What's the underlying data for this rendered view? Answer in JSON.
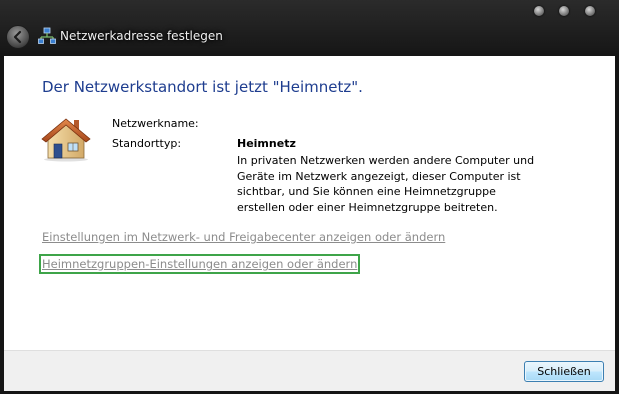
{
  "window": {
    "title": "Netzwerkadresse festlegen",
    "icons": {
      "back": "back-arrow-icon",
      "network": "network-icon",
      "location": "house-icon"
    }
  },
  "main": {
    "heading": "Der Netzwerkstandort ist jetzt \"Heimnetz\".",
    "network_name_label": "Netzwerkname:",
    "network_name_value": "",
    "location_type_label": "Standorttyp:",
    "location_type_value": "Heimnetz",
    "description": "In privaten Netzwerken werden andere Computer und Geräte im Netzwerk angezeigt, dieser Computer ist sichtbar, und Sie können eine Heimnetzgruppe erstellen oder einer Heimnetzgruppe beitreten.",
    "links": [
      {
        "label": "Einstellungen im Netzwerk- und Freigabecenter anzeigen oder ändern"
      },
      {
        "label": "Heimnetzgruppen-Einstellungen anzeigen oder ändern"
      }
    ]
  },
  "footer": {
    "close_label": "Schließen"
  },
  "colors": {
    "heading": "#1e3d8f",
    "link": "#8c8c8c",
    "focus_outline": "#3ea449",
    "button_border": "#3c7fb1"
  }
}
